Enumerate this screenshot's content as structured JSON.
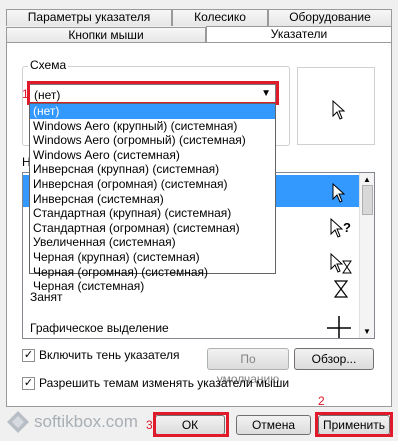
{
  "tabs_row1": [
    "Параметры указателя",
    "Колесико",
    "Оборудование"
  ],
  "tabs_row2": [
    "Кнопки мыши",
    "Указатели"
  ],
  "scheme": {
    "legend": "Схема",
    "selected": "(нет)",
    "options": [
      "(нет)",
      "Windows Aero (крупный) (системная)",
      "Windows Aero (огромный) (системная)",
      "Windows Aero (системная)",
      "Инверсная (крупная) (системная)",
      "Инверсная (огромная) (системная)",
      "Инверсная (системная)",
      "Стандартная (крупная) (системная)",
      "Стандартная (огромная) (системная)",
      "Увеличенная (системная)",
      "Черная (крупная) (системная)",
      "Черная (огромная) (системная)",
      "Черная (системная)"
    ]
  },
  "settings_label_fragment": "Н",
  "cursor_rows": [
    {
      "label": ""
    },
    {
      "label": ""
    },
    {
      "label": ""
    },
    {
      "label": "Занят"
    },
    {
      "label": "Графическое выделение"
    }
  ],
  "checkbox_shadow": "Включить тень указателя",
  "checkbox_themes": "Разрешить темам изменять указатели мыши",
  "buttons": {
    "default": "По умолчанию",
    "browse": "Обзор...",
    "ok": "ОК",
    "cancel": "Отмена",
    "apply": "Применить"
  },
  "annotations": {
    "n1": "1",
    "n2": "2",
    "n3": "3"
  },
  "watermark": "softikbox.com"
}
